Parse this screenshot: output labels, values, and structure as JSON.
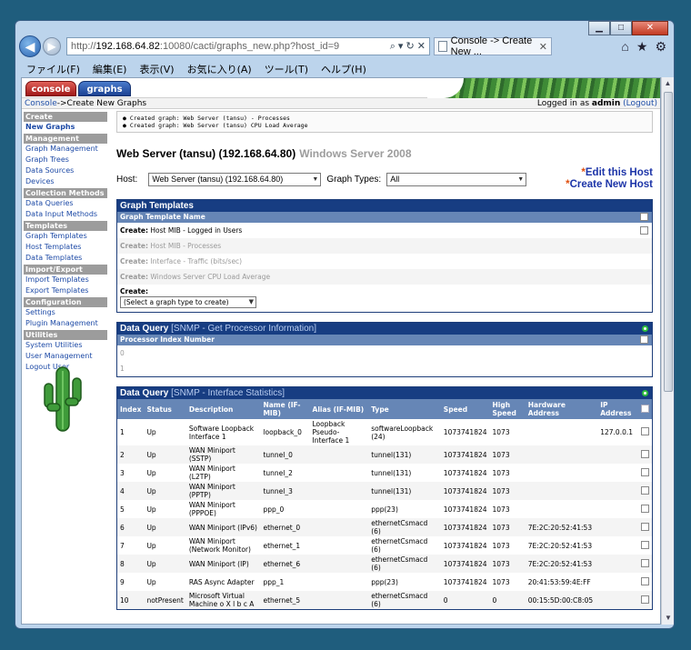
{
  "browser": {
    "address": {
      "prefix": "http://",
      "host": "192.168.64.82",
      "path": ":10080/cacti/graphs_new.php?host_id=9"
    },
    "tab_title": "Console -> Create New ...",
    "menu": [
      "ファイル(F)",
      "編集(E)",
      "表示(V)",
      "お気に入り(A)",
      "ツール(T)",
      "ヘルプ(H)"
    ]
  },
  "tabs": {
    "console": "console",
    "graphs": "graphs"
  },
  "breadcrumb": {
    "root": "Console",
    "sep": " -> ",
    "page": "Create New Graphs"
  },
  "login": {
    "prefix": "Logged in as ",
    "user": "admin",
    "logout": "(Logout)"
  },
  "sidebar": [
    {
      "type": "hdr",
      "label": "Create"
    },
    {
      "type": "item",
      "label": "New Graphs",
      "active": true
    },
    {
      "type": "hdr",
      "label": "Management"
    },
    {
      "type": "item",
      "label": "Graph Management"
    },
    {
      "type": "item",
      "label": "Graph Trees"
    },
    {
      "type": "item",
      "label": "Data Sources"
    },
    {
      "type": "item",
      "label": "Devices"
    },
    {
      "type": "hdr",
      "label": "Collection Methods"
    },
    {
      "type": "item",
      "label": "Data Queries"
    },
    {
      "type": "item",
      "label": "Data Input Methods"
    },
    {
      "type": "hdr",
      "label": "Templates"
    },
    {
      "type": "item",
      "label": "Graph Templates"
    },
    {
      "type": "item",
      "label": "Host Templates"
    },
    {
      "type": "item",
      "label": "Data Templates"
    },
    {
      "type": "hdr",
      "label": "Import/Export"
    },
    {
      "type": "item",
      "label": "Import Templates"
    },
    {
      "type": "item",
      "label": "Export Templates"
    },
    {
      "type": "hdr",
      "label": "Configuration"
    },
    {
      "type": "item",
      "label": "Settings"
    },
    {
      "type": "item",
      "label": "Plugin Management"
    },
    {
      "type": "hdr",
      "label": "Utilities"
    },
    {
      "type": "item",
      "label": "System Utilities"
    },
    {
      "type": "item",
      "label": "User Management"
    },
    {
      "type": "item",
      "label": "Logout User"
    }
  ],
  "messages": [
    "Created graph: Web Server (tansu) - Processes",
    "Created graph: Web Server (tansu) CPU Load Average"
  ],
  "host": {
    "title": "Web Server (tansu) (192.168.64.80)",
    "os": "Windows Server 2008",
    "host_label": "Host:",
    "host_value": "Web Server (tansu) (192.168.64.80)",
    "types_label": "Graph Types:",
    "types_value": "All",
    "edit_link": "Edit this Host",
    "new_link": "Create New Host"
  },
  "graph_templates": {
    "title": "Graph Templates",
    "column": "Graph Template Name",
    "rows": [
      {
        "prefix": "Create:",
        "name": "Host MIB - Logged in Users",
        "dim": false
      },
      {
        "prefix": "Create:",
        "name": "Host MIB - Processes",
        "dim": true
      },
      {
        "prefix": "Create:",
        "name": "Interface - Traffic (bits/sec)",
        "dim": true
      },
      {
        "prefix": "Create:",
        "name": "Windows Server CPU Load Average",
        "dim": true
      }
    ],
    "create_label": "Create:",
    "create_select": "(Select a graph type to create)"
  },
  "processor_query": {
    "title": "Data Query",
    "sub": "[SNMP - Get Processor Information]",
    "column": "Processor Index Number",
    "rows": [
      "0",
      "1"
    ]
  },
  "interface_query": {
    "title": "Data Query",
    "sub": "[SNMP - Interface Statistics]",
    "columns": [
      "Index",
      "Status",
      "Description",
      "Name (IF-MIB)",
      "Alias (IF-MIB)",
      "Type",
      "Speed",
      "High Speed",
      "Hardware Address",
      "IP Address"
    ],
    "rows": [
      [
        "1",
        "Up",
        "Software Loopback Interface 1",
        "loopback_0",
        "Loopback Pseudo-Interface 1",
        "softwareLoopback (24)",
        "1073741824",
        "1073",
        "",
        "127.0.0.1"
      ],
      [
        "2",
        "Up",
        "WAN Miniport (SSTP)",
        "tunnel_0",
        "",
        "tunnel(131)",
        "1073741824",
        "1073",
        "",
        ""
      ],
      [
        "3",
        "Up",
        "WAN Miniport (L2TP)",
        "tunnel_2",
        "",
        "tunnel(131)",
        "1073741824",
        "1073",
        "",
        ""
      ],
      [
        "4",
        "Up",
        "WAN Miniport (PPTP)",
        "tunnel_3",
        "",
        "tunnel(131)",
        "1073741824",
        "1073",
        "",
        ""
      ],
      [
        "5",
        "Up",
        "WAN Miniport (PPPOE)",
        "ppp_0",
        "",
        "ppp(23)",
        "1073741824",
        "1073",
        "",
        ""
      ],
      [
        "6",
        "Up",
        "WAN Miniport (IPv6)",
        "ethernet_0",
        "",
        "ethernetCsmacd (6)",
        "1073741824",
        "1073",
        "7E:2C:20:52:41:53",
        ""
      ],
      [
        "7",
        "Up",
        "WAN Miniport (Network Monitor)",
        "ethernet_1",
        "",
        "ethernetCsmacd (6)",
        "1073741824",
        "1073",
        "7E:2C:20:52:41:53",
        ""
      ],
      [
        "8",
        "Up",
        "WAN Miniport (IP)",
        "ethernet_6",
        "",
        "ethernetCsmacd (6)",
        "1073741824",
        "1073",
        "7E:2C:20:52:41:53",
        ""
      ],
      [
        "9",
        "Up",
        "RAS Async Adapter",
        "ppp_1",
        "",
        "ppp(23)",
        "1073741824",
        "1073",
        "20:41:53:59:4E:FF",
        ""
      ],
      [
        "10",
        "notPresent",
        "Microsoft Virtual Machine o X l b c A",
        "ethernet_5",
        "",
        "ethernetCsmacd (6)",
        "0",
        "0",
        "00:15:5D:00:C8:05",
        ""
      ]
    ]
  },
  "colors": {
    "panel_header": "#173d82",
    "column_header": "#6686b6",
    "link": "#1d4aa6",
    "side_header": "#9c9c9c"
  }
}
